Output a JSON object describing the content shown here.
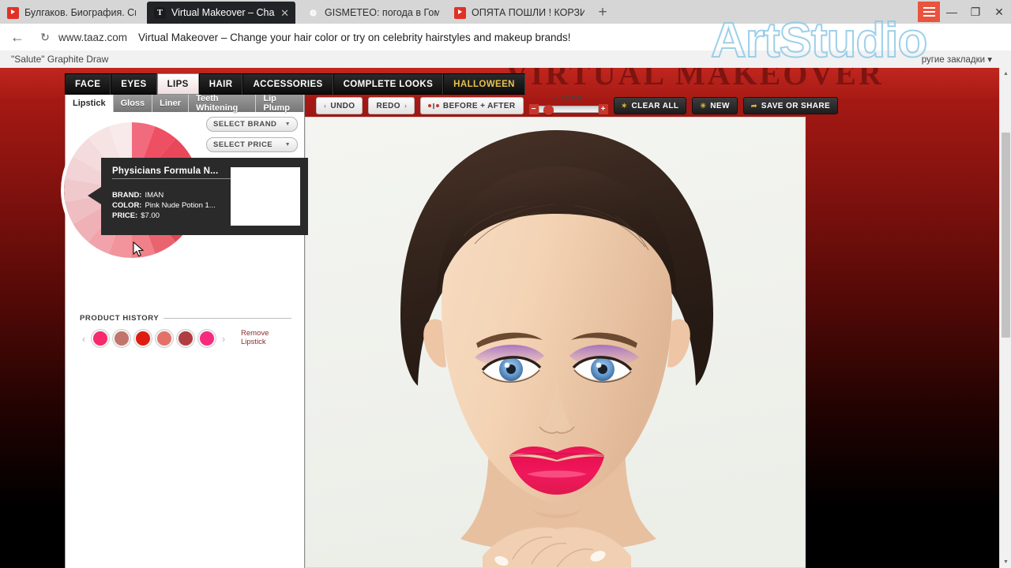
{
  "browser": {
    "tabs": [
      {
        "label": "Булгаков. Биография. Скрь",
        "favicon": "youtube-icon",
        "active": false
      },
      {
        "label": "Virtual Makeover – Chang",
        "favicon": "taaz-icon",
        "active": true
      },
      {
        "label": "GISMETEO: погода в Гомел",
        "favicon": "gismeteo-icon",
        "active": false
      },
      {
        "label": "ОПЯТА ПОШЛИ ! КОРЗИН",
        "favicon": "youtube-icon",
        "active": false
      }
    ],
    "new_tab_label": "+",
    "window_controls": {
      "menu": "≡",
      "minimize": "—",
      "maximize": "❐",
      "close": "✕"
    },
    "back_label": "←",
    "reload_label": "↻",
    "url_host": "www.taaz.com",
    "url_title": "Virtual Makeover – Change your hair color or try on celebrity hairstyles and makeup brands!",
    "bookmark_label": "\"Salute\" Graphite Draw",
    "other_bookmarks_label": "ругиe заклaдки"
  },
  "site": {
    "banner_word": "VIRTUAL MAKEOVER",
    "watermark": "ArtStudio"
  },
  "mainnav": [
    {
      "label": "FACE",
      "selected": false
    },
    {
      "label": "EYES",
      "selected": false
    },
    {
      "label": "LIPS",
      "selected": true
    },
    {
      "label": "HAIR",
      "selected": false
    },
    {
      "label": "ACCESSORIES",
      "selected": false
    },
    {
      "label": "COMPLETE LOOKS",
      "selected": false
    },
    {
      "label": "HALLOWEEN",
      "selected": false,
      "accent": true
    }
  ],
  "subtabs": [
    {
      "label": "Lipstick",
      "selected": true
    },
    {
      "label": "Gloss",
      "selected": false
    },
    {
      "label": "Liner",
      "selected": false
    },
    {
      "label": "Teeth Whitening",
      "selected": false
    },
    {
      "label": "Lip Plump",
      "selected": false
    }
  ],
  "filters": [
    {
      "label": "SELECT BRAND",
      "caret": "▼"
    },
    {
      "label": "SELECT PRICE",
      "caret": "▼"
    }
  ],
  "tooltip": {
    "title": "Physicians Formula N...",
    "brand_label": "BRAND:",
    "brand_value": "IMAN",
    "color_label": "COLOR:",
    "color_value": "Pink Nude Potion 1...",
    "price_label": "PRICE:",
    "price_value": "$7.00"
  },
  "product_history": {
    "title": "PRODUCT HISTORY",
    "prev_arrow": "‹",
    "next_arrow": "›",
    "remove_line1": "Remove",
    "remove_line2": "Lipstick",
    "swatches": [
      "#f72a6e",
      "#c2756c",
      "#de1c10",
      "#e3716a",
      "#b03d42",
      "#f72a7e"
    ]
  },
  "toolbar": {
    "undo": "UNDO",
    "undo_icon": "‹",
    "redo": "REDO",
    "redo_icon": "›",
    "before_after": "BEFORE + AFTER",
    "zoom_label": "ZOOM",
    "zoom_magnifier": "⌕",
    "zoom_minus": "−",
    "zoom_plus": "+",
    "zoom_value": 8,
    "clear_all": "CLEAR ALL",
    "clear_icon": "✶",
    "new": "NEW",
    "new_icon": "✳",
    "save_or_share": "SAVE OR SHARE",
    "save_icon": "➦"
  },
  "colors": {
    "accent_red": "#c0261e",
    "lip_pink": "#f0185c",
    "panel_bg": "#ffffff",
    "tooltip_bg": "#2a2a2a",
    "eye_blue": "#6d9fd4",
    "eyeshadow_purple": "#a878c4"
  },
  "wheel_segments": [
    "#f26a7e",
    "#ef4f63",
    "#e8485a",
    "#e24152",
    "#df2f3f",
    "#d9273a",
    "#e04a55",
    "#ea6470",
    "#f08089",
    "#f3939c",
    "#f2a2aa",
    "#efb0b6",
    "#eebec3",
    "#f0c9cd",
    "#f2d3d6",
    "#f4dcde",
    "#f6e3e4",
    "#f8eaea"
  ]
}
